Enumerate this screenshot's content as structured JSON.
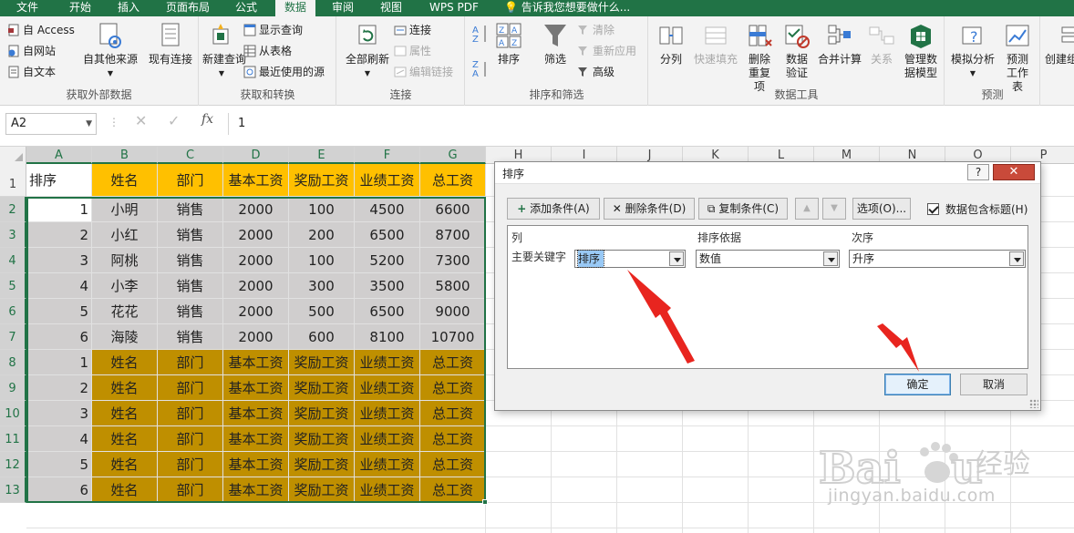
{
  "tabs": [
    {
      "label": "文件",
      "active": false
    },
    {
      "label": "开始",
      "active": false
    },
    {
      "label": "插入",
      "active": false
    },
    {
      "label": "页面布局",
      "active": false
    },
    {
      "label": "公式",
      "active": false
    },
    {
      "label": "数据",
      "active": true
    },
    {
      "label": "审阅",
      "active": false
    },
    {
      "label": "视图",
      "active": false
    },
    {
      "label": "WPS PDF",
      "active": false
    },
    {
      "label": "告诉我您想要做什么...",
      "active": false
    }
  ],
  "ribbon": {
    "get_external": {
      "label": "获取外部数据",
      "from_access": "自 Access",
      "from_web": "自网站",
      "from_text": "自文本",
      "other_sources": "自其他来源",
      "existing_conn": "现有连接"
    },
    "get_transform": {
      "label": "获取和转换",
      "new_query": "新建查询",
      "show_query": "显示查询",
      "from_table": "从表格",
      "recent_sources": "最近使用的源"
    },
    "connections": {
      "label": "连接",
      "refresh_all": "全部刷新",
      "connections": "连接",
      "properties": "属性",
      "edit_links": "编辑链接"
    },
    "sort_filter": {
      "label": "排序和筛选",
      "sort": "排序",
      "filter": "筛选",
      "clear": "清除",
      "reapply": "重新应用",
      "advanced": "高级"
    },
    "data_tools": {
      "label": "数据工具",
      "text_to_columns": "分列",
      "flash_fill": "快速填充",
      "remove_dup": "删除重复项",
      "validation": "数据验证",
      "consolidate": "合并计算",
      "relationships": "关系",
      "data_model": "管理数据模型"
    },
    "forecast": {
      "label": "预测",
      "what_if": "模拟分析",
      "forecast_sheet": "预测工作表"
    },
    "outline": {
      "create": "创建组"
    }
  },
  "formula_bar": {
    "name_box": "A2",
    "cancel": "✕",
    "enter": "✓",
    "fx": "fx",
    "value": "1"
  },
  "columns": [
    "A",
    "B",
    "C",
    "D",
    "E",
    "F",
    "G",
    "H",
    "I",
    "J",
    "K",
    "L",
    "M",
    "N",
    "O",
    "P"
  ],
  "rows": [
    "1",
    "2",
    "3",
    "4",
    "5",
    "6",
    "7",
    "8",
    "9",
    "10",
    "11",
    "12",
    "13"
  ],
  "sheet": {
    "cells": [
      [
        "排序",
        "姓名",
        "部门",
        "基本工资",
        "奖励工资",
        "业绩工资",
        "总工资"
      ],
      [
        "1",
        "小明",
        "销售",
        "2000",
        "100",
        "4500",
        "6600"
      ],
      [
        "2",
        "小红",
        "销售",
        "2000",
        "200",
        "6500",
        "8700"
      ],
      [
        "3",
        "阿桃",
        "销售",
        "2000",
        "100",
        "5200",
        "7300"
      ],
      [
        "4",
        "小李",
        "销售",
        "2000",
        "300",
        "3500",
        "5800"
      ],
      [
        "5",
        "花花",
        "销售",
        "2000",
        "500",
        "6500",
        "9000"
      ],
      [
        "6",
        "海陵",
        "销售",
        "2000",
        "600",
        "8100",
        "10700"
      ],
      [
        "1",
        "姓名",
        "部门",
        "基本工资",
        "奖励工资",
        "业绩工资",
        "总工资"
      ],
      [
        "2",
        "姓名",
        "部门",
        "基本工资",
        "奖励工资",
        "业绩工资",
        "总工资"
      ],
      [
        "3",
        "姓名",
        "部门",
        "基本工资",
        "奖励工资",
        "业绩工资",
        "总工资"
      ],
      [
        "4",
        "姓名",
        "部门",
        "基本工资",
        "奖励工资",
        "业绩工资",
        "总工资"
      ],
      [
        "5",
        "姓名",
        "部门",
        "基本工资",
        "奖励工资",
        "业绩工资",
        "总工资"
      ],
      [
        "6",
        "姓名",
        "部门",
        "基本工资",
        "奖励工资",
        "业绩工资",
        "总工资"
      ]
    ],
    "colors": {
      "header_fill": "#ffc000",
      "data_fill": "#d0cece",
      "dark_fill": "#bf8f00",
      "selection": "#217346"
    }
  },
  "dialog": {
    "title": "排序",
    "help": "?",
    "close": "✕",
    "add_level": "添加条件(A)",
    "delete_level": "删除条件(D)",
    "copy_level": "复制条件(C)",
    "move_up": "▲",
    "move_down": "▼",
    "options": "选项(O)...",
    "has_headers": "数据包含标题(H)",
    "col_header": "列",
    "sort_on_header": "排序依据",
    "order_header": "次序",
    "primary_key": "主要关键字",
    "column_value": "排序",
    "sort_on_value": "数值",
    "order_value": "升序",
    "ok": "确定",
    "cancel": "取消"
  },
  "watermark": {
    "url": "jingyan.baidu.com",
    "cn": "经验"
  }
}
